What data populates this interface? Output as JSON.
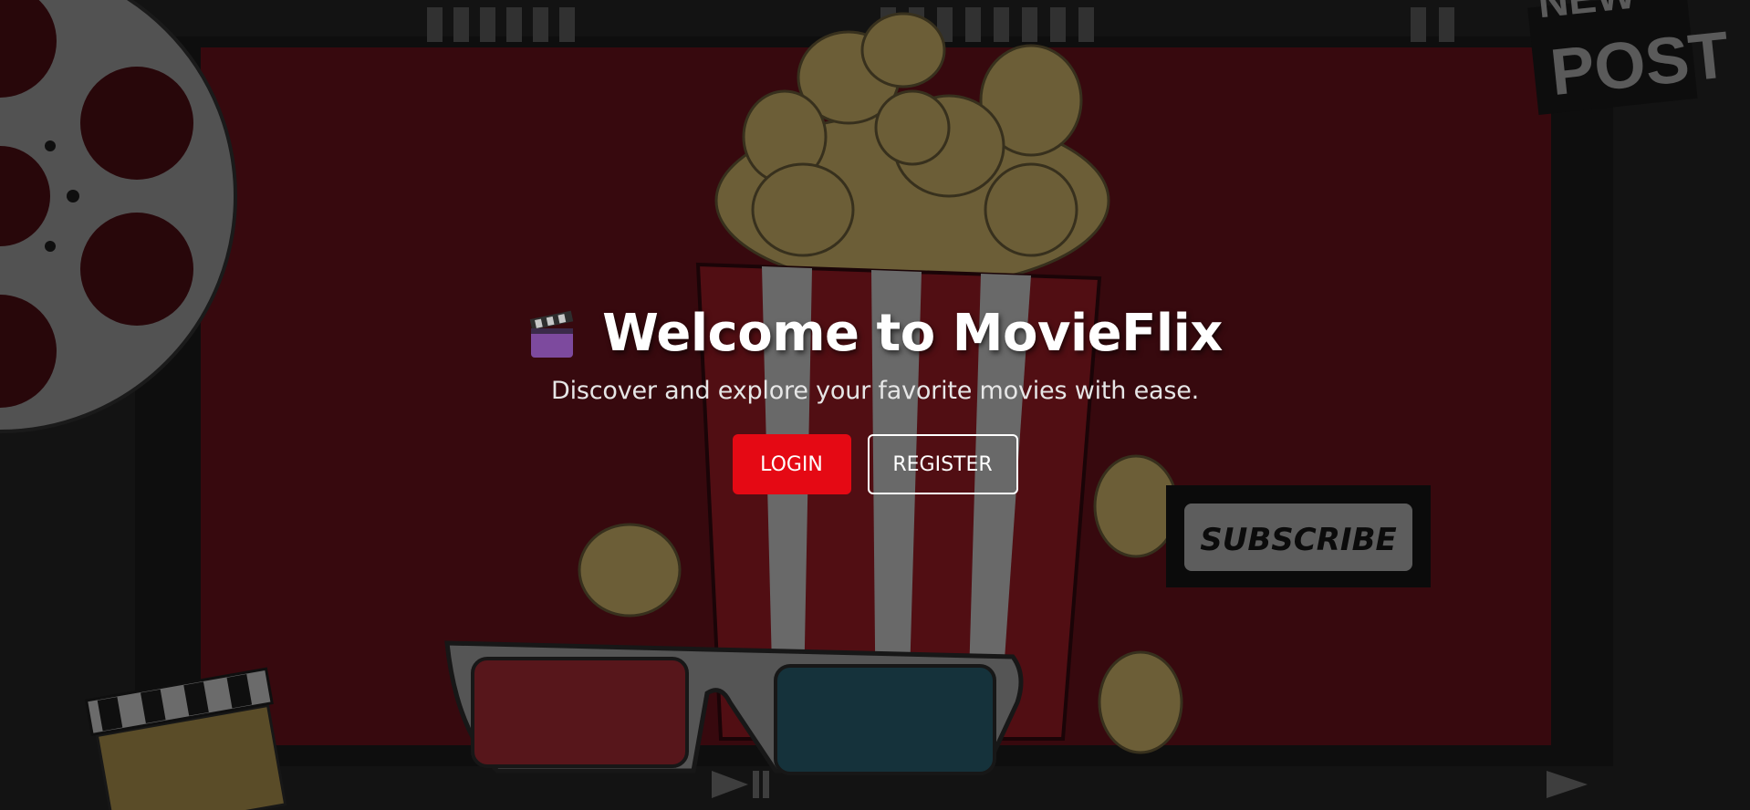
{
  "hero": {
    "emoji": "🎬",
    "title": "Welcome to MovieFlix",
    "subtitle": "Discover and explore your favorite movies with ease."
  },
  "actions": {
    "login_label": "LOGIN",
    "register_label": "REGISTER"
  },
  "decor": {
    "subscribe_text": "SUBSCRIBE",
    "new_post_line1": "NEW",
    "new_post_line2": "POST"
  },
  "colors": {
    "brand_red": "#e50914",
    "frame_red": "#7a1420",
    "popcorn_yellow": "#f2d27a",
    "lens_red": "#c0313c",
    "lens_blue": "#2f6f84"
  }
}
